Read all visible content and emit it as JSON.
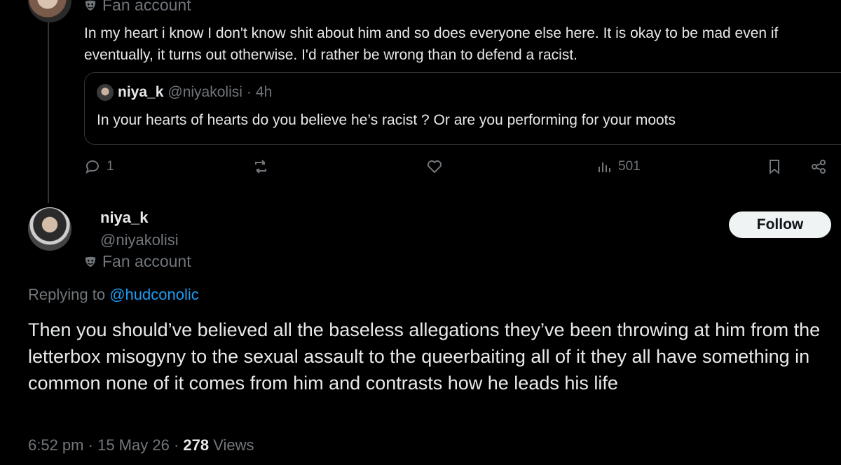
{
  "top_reply": {
    "fan_label": "Fan account",
    "text": "In my heart i know I don't know shit about him and so does everyone else here. It is okay to be mad even if eventually, it turns out otherwise. I'd rather be wrong than to defend a racist."
  },
  "quoted_tweet": {
    "name": "niya_k",
    "handle": "@niyakolisi",
    "separator": "·",
    "time": "4h",
    "text": "In your hearts of hearts do you believe he’s racist ? Or are you performing for your moots"
  },
  "actions": {
    "replies": "1",
    "views": "501"
  },
  "main_tweet": {
    "name": "niya_k",
    "handle": "@niyakolisi",
    "fan_label": "Fan account",
    "follow_label": "Follow",
    "replying_prefix": "Replying to",
    "replying_to": "@hudconolic",
    "text": "Then you should’ve believed all the baseless allegations they’ve been throwing at him from the letterbox misogyny to the sexual assault to the queerbaiting all of it they all have something in common none of it comes from him and contrasts how he leads his life",
    "time": "6:52 pm",
    "sep1": "·",
    "date": "15 May 26",
    "sep2": "·",
    "views_count": "278",
    "views_label": "Views"
  },
  "colors": {
    "background": "#000000",
    "text": "#e7e9ea",
    "muted": "#71767b",
    "link": "#1d9bf0",
    "border": "#2f3336",
    "follow_bg": "#eff3f4"
  }
}
